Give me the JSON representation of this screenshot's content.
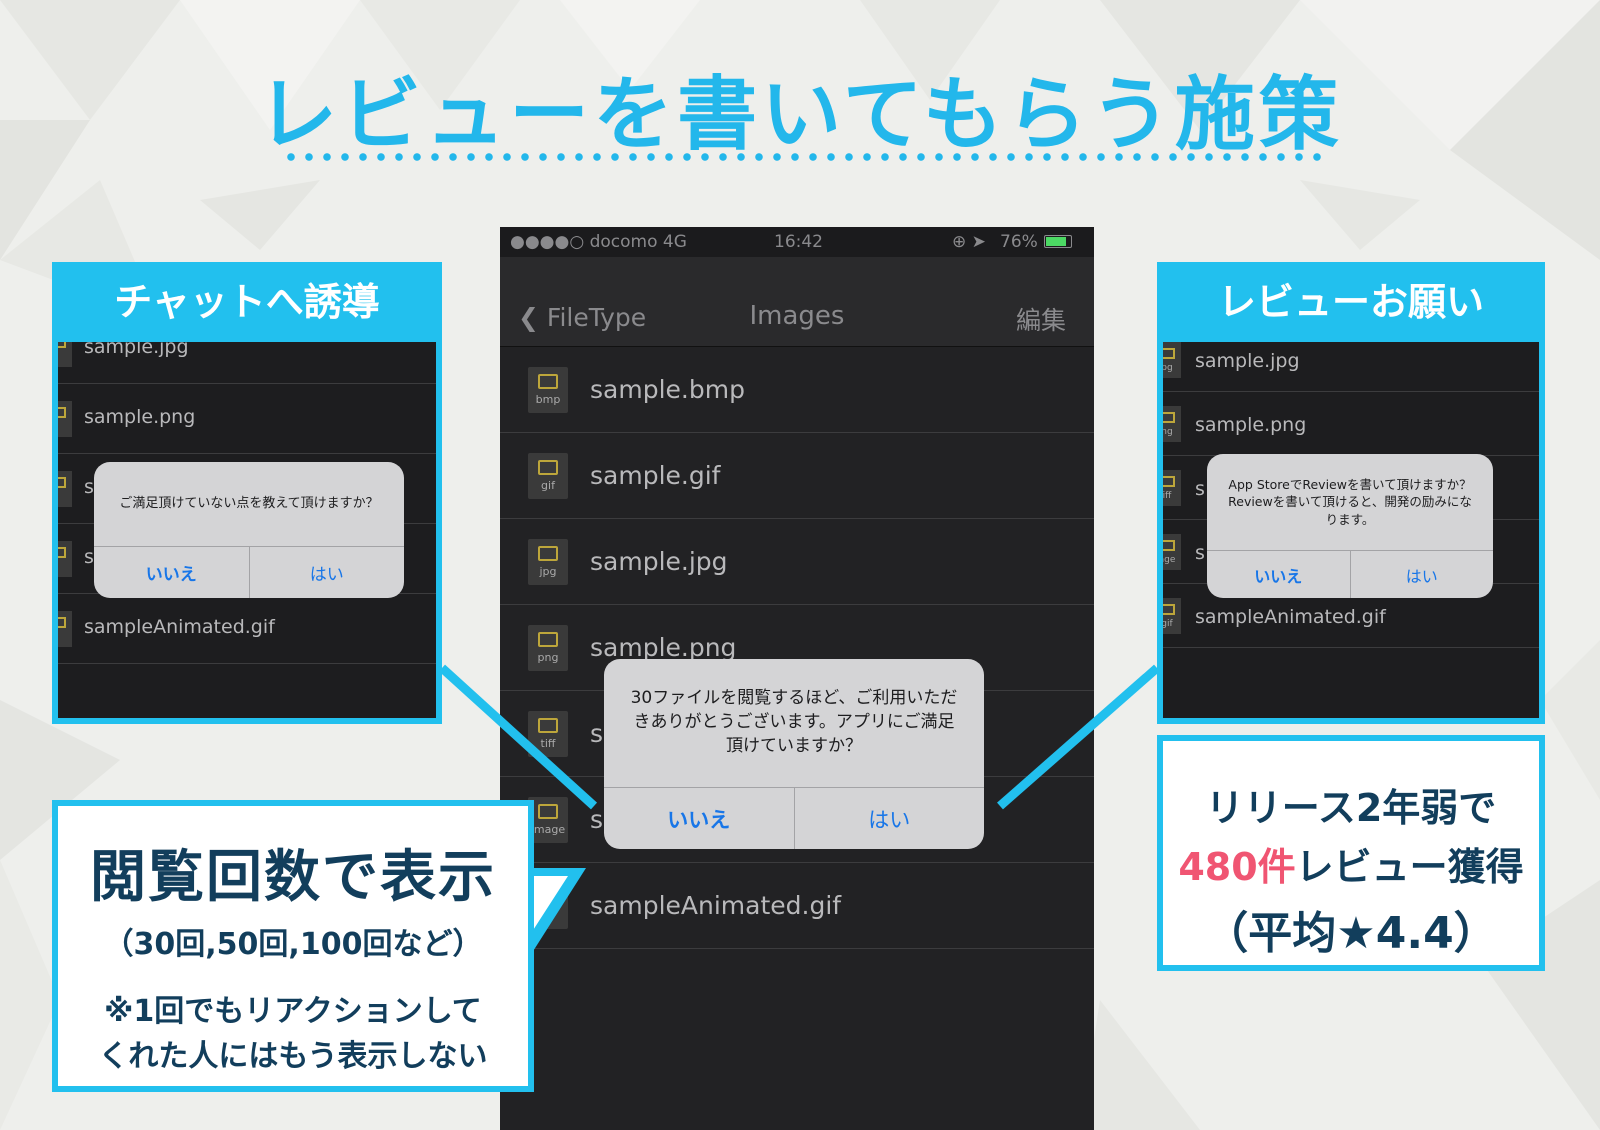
{
  "title": "レビューを書いてもらう施策",
  "phone": {
    "status": {
      "carrier": "●●●●○ docomo  4G",
      "time": "16:42",
      "battery": "76%"
    },
    "nav": {
      "back": "FileType",
      "title": "Images",
      "edit": "編集"
    },
    "files": [
      {
        "name": "sample.bmp",
        "ext": "bmp"
      },
      {
        "name": "sample.gif",
        "ext": "gif"
      },
      {
        "name": "sample.jpg",
        "ext": "jpg"
      },
      {
        "name": "sample.png",
        "ext": "png"
      },
      {
        "name": "s",
        "ext": "tiff"
      },
      {
        "name": "s",
        "ext": "image"
      },
      {
        "name": "sampleAnimated.gif",
        "ext": "gif"
      }
    ],
    "alert": {
      "message": "30ファイルを閲覧するほど、ご利用いただきありがとうございます。アプリにご満足頂けていますか？",
      "no": "いいえ",
      "yes": "はい"
    }
  },
  "left_panel": {
    "title": "チャットへ誘導",
    "files": [
      "sample.jpg",
      "sample.png",
      "s",
      "s",
      "sampleAnimated.gif"
    ],
    "alert": {
      "message": "ご満足頂けていない点を教えて頂けますか？",
      "no": "いいえ",
      "yes": "はい"
    }
  },
  "right_panel": {
    "title": "レビューお願い",
    "files": [
      "sample.jpg",
      "sample.png",
      "s",
      "s",
      "sampleAnimated.gif"
    ],
    "exts": [
      "pg",
      "ng",
      "iff",
      "age",
      "gif"
    ],
    "alert": {
      "message": "App StoreでReviewを書いて頂けますか？Reviewを書いて頂けると、開発の励みになります。",
      "no": "いいえ",
      "yes": "はい"
    }
  },
  "callout_left": {
    "headline": "閲覧回数で表示",
    "examples": "（30回,50回,100回など）",
    "note_line1": "※1回でもリアクションして",
    "note_line2": "くれた人にはもう表示しない"
  },
  "callout_right": {
    "line1": "リリース2年弱で",
    "count": "480件",
    "line2_rest": "レビュー獲得",
    "line3": "（平均★4.4）"
  },
  "colors": {
    "accent": "#22c0ee",
    "title": "#23b7eb",
    "highlight": "#f05572",
    "text_dark": "#123e5c",
    "ios_blue": "#1876e8"
  }
}
